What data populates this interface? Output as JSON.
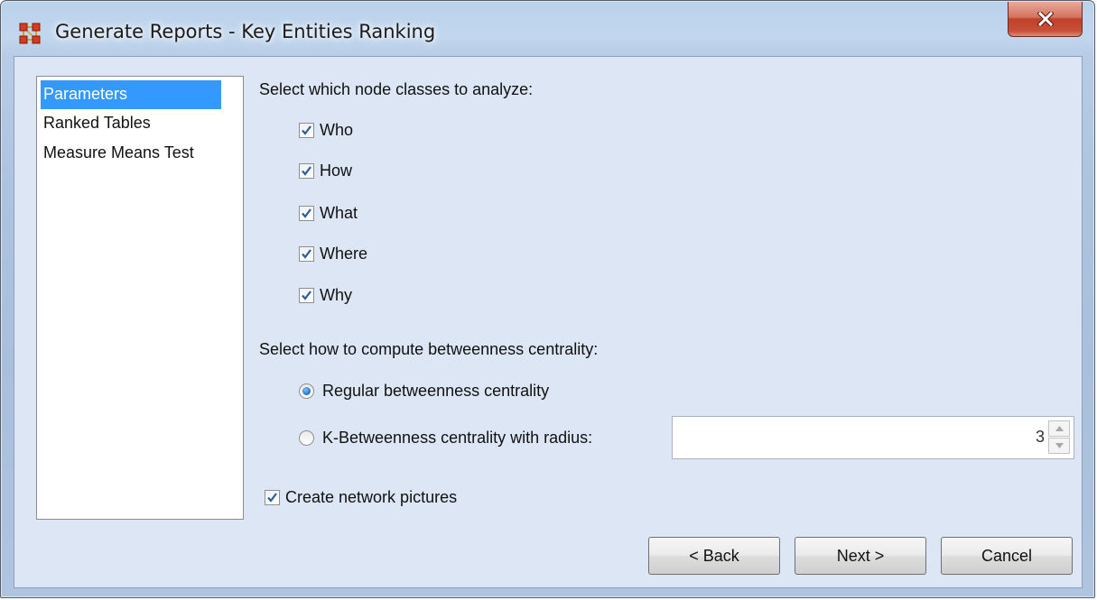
{
  "window": {
    "title": "Generate Reports - Key Entities Ranking",
    "close_glyph": "x"
  },
  "nav": {
    "items": [
      {
        "label": "Parameters",
        "selected": true
      },
      {
        "label": "Ranked Tables",
        "selected": false
      },
      {
        "label": "Measure Means Test",
        "selected": false
      }
    ]
  },
  "node_classes": {
    "label": "Select which node classes to analyze:",
    "options": [
      {
        "label": "Who",
        "checked": true
      },
      {
        "label": "How",
        "checked": true
      },
      {
        "label": "What",
        "checked": true
      },
      {
        "label": "Where",
        "checked": true
      },
      {
        "label": "Why",
        "checked": true
      }
    ]
  },
  "betweenness": {
    "label": "Select how to compute betweenness centrality:",
    "regular_label": "Regular betweenness centrality",
    "k_label": "K-Betweenness centrality with radius:",
    "selected": "regular",
    "radius_value": "3"
  },
  "pictures": {
    "label": "Create network pictures",
    "checked": true
  },
  "buttons": {
    "back": "< Back",
    "next": "Next >",
    "cancel": "Cancel"
  },
  "colors": {
    "selection": "#3399ff",
    "client_bg": "#dce6f4",
    "close_red": "#c24128"
  },
  "icons": {
    "app": "network-nodes-icon",
    "close": "close-icon",
    "check": "checkmark-icon",
    "spin_up": "spin-up-icon",
    "spin_down": "spin-down-icon"
  }
}
